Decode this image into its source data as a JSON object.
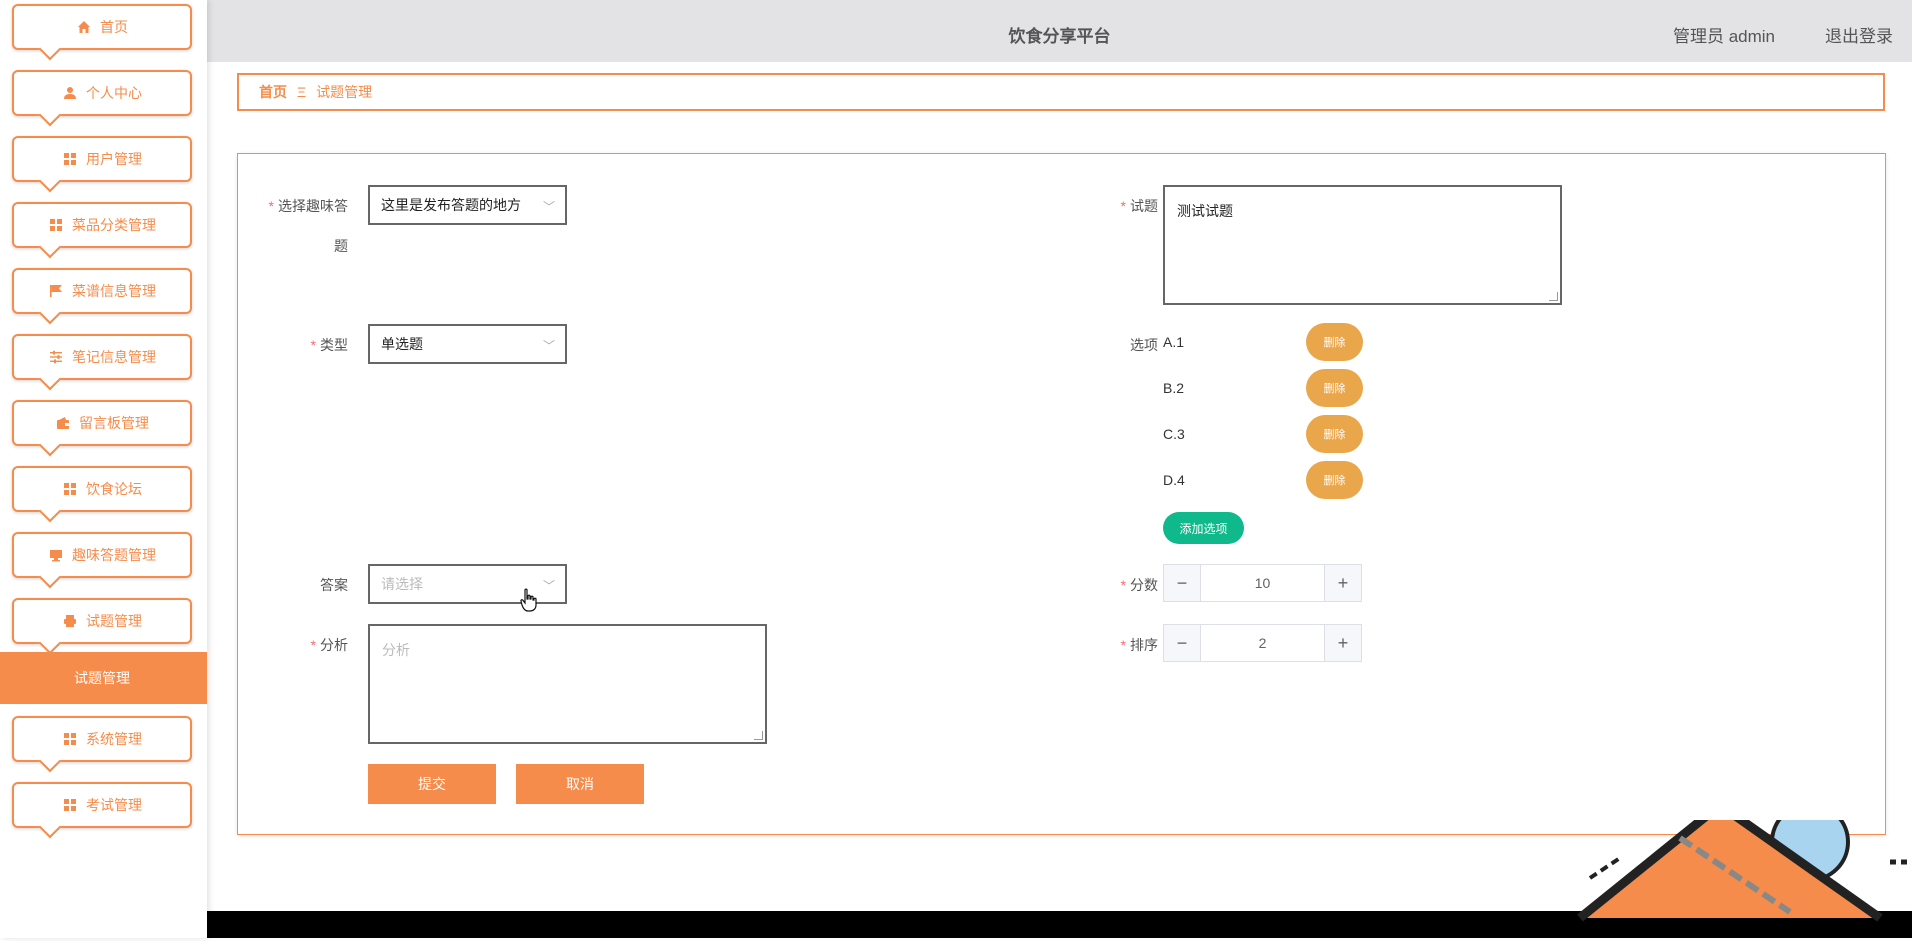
{
  "header": {
    "title": "饮食分享平台",
    "user": "管理员 admin",
    "logout": "退出登录"
  },
  "sidebar": {
    "items": [
      {
        "label": "首页",
        "icon": "home-icon"
      },
      {
        "label": "个人中心",
        "icon": "user-icon"
      },
      {
        "label": "用户管理",
        "icon": "grid-icon"
      },
      {
        "label": "菜品分类管理",
        "icon": "grid-icon"
      },
      {
        "label": "菜谱信息管理",
        "icon": "flag-icon"
      },
      {
        "label": "笔记信息管理",
        "icon": "sliders-icon"
      },
      {
        "label": "留言板管理",
        "icon": "wallet-icon"
      },
      {
        "label": "饮食论坛",
        "icon": "grid-icon"
      },
      {
        "label": "趣味答题管理",
        "icon": "monitor-icon"
      },
      {
        "label": "试题管理",
        "icon": "printer-icon"
      }
    ],
    "active_sub": "试题管理",
    "items_after": [
      {
        "label": "系统管理",
        "icon": "grid-icon"
      },
      {
        "label": "考试管理",
        "icon": "grid-icon"
      }
    ]
  },
  "breadcrumb": {
    "home": "首页",
    "separator": "Ξ",
    "current": "试题管理"
  },
  "form": {
    "quiz_label_line1": "选择趣味答",
    "quiz_label_line2": "题",
    "quiz_value": "这里是发布答题的地方",
    "type_label": "类型",
    "type_value": "单选题",
    "answer_label": "答案",
    "answer_placeholder": "请选择",
    "analysis_label": "分析",
    "analysis_placeholder": "分析",
    "question_label": "试题",
    "question_value": "测试试题",
    "options_label": "选项",
    "options": [
      "A.1",
      "B.2",
      "C.3",
      "D.4"
    ],
    "delete_label": "删除",
    "add_option_label": "添加选项",
    "score_label": "分数",
    "score_value": "10",
    "order_label": "排序",
    "order_value": "2",
    "submit_label": "提交",
    "cancel_label": "取消"
  },
  "colors": {
    "accent": "#f58c4b",
    "delete": "#e9a64a",
    "add": "#10b98b",
    "header_bg": "#e3e3e5"
  }
}
